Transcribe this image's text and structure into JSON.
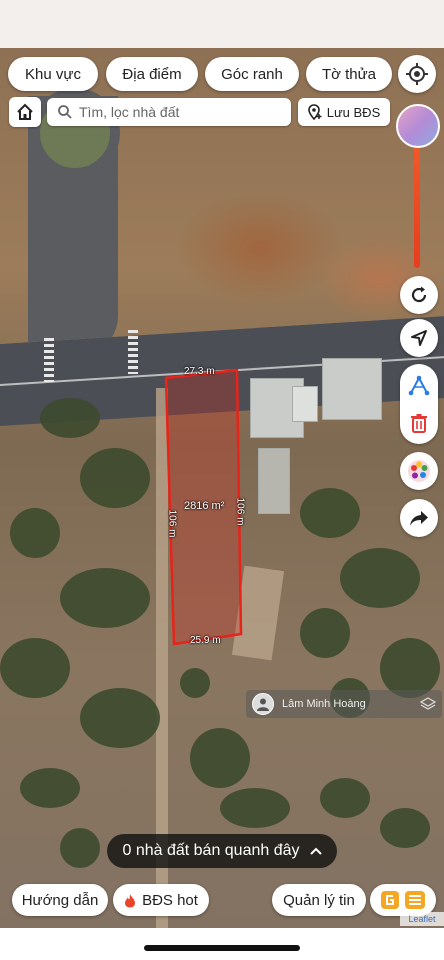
{
  "status_bar": {
    "time": ""
  },
  "filters": [
    {
      "label": "Khu vực"
    },
    {
      "label": "Địa điểm"
    },
    {
      "label": "Góc ranh"
    },
    {
      "label": "Tờ thửa"
    }
  ],
  "search": {
    "placeholder": "Tìm, lọc nhà đất",
    "icon": "search-icon"
  },
  "save_button": {
    "label": "Lưu BĐS",
    "icon": "location-pin-plus-icon"
  },
  "home_icon": "home-icon",
  "locate_icon": "crosshair-icon",
  "plot": {
    "area": "2816 m²",
    "top": "27.3 m",
    "bottom": "25.9 m",
    "left": "106 m",
    "right": "106 m",
    "outline_color": "#e8231a"
  },
  "side_tools": [
    {
      "icon": "refresh-icon"
    },
    {
      "icon": "navigate-arrow-icon"
    },
    {
      "icon": "measure-tool-icon"
    },
    {
      "icon": "trash-icon"
    },
    {
      "icon": "palette-icon"
    },
    {
      "icon": "share-icon"
    }
  ],
  "user_tag": {
    "name": "Lâm Minh Hoàng"
  },
  "nearby": {
    "label": "0 nhà đất bán quanh đây",
    "icon": "chevron-up-icon"
  },
  "bottom_buttons": {
    "guide": "Hướng dẫn",
    "hot": "BĐS hot",
    "manage": "Quản lý tin"
  },
  "attribution": "Leaflet",
  "colors": {
    "accent": "#f5a623",
    "slider": "#e63d1f"
  }
}
